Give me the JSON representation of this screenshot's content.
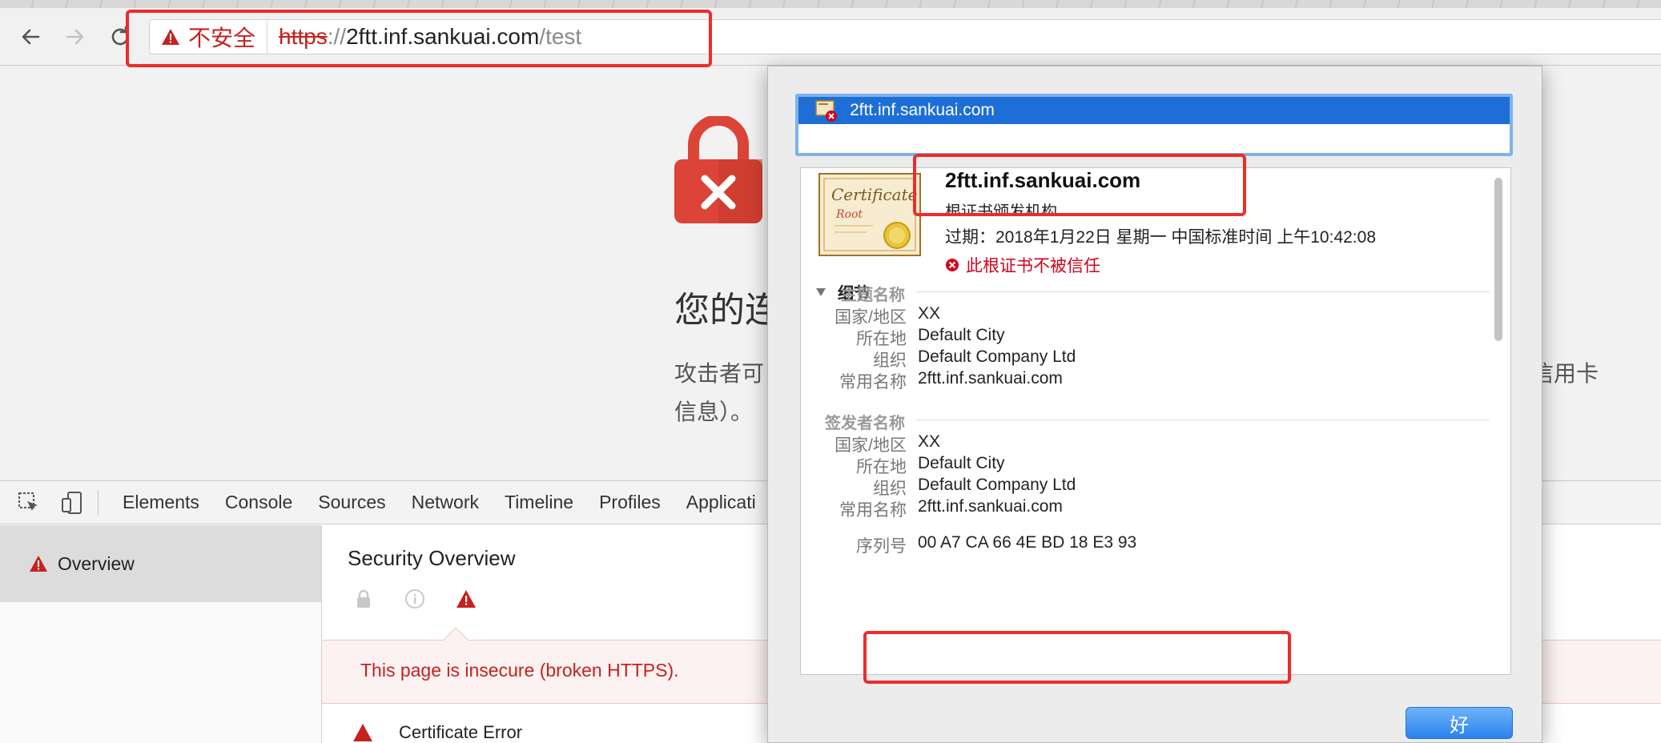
{
  "browser": {
    "security_chip": "不安全",
    "url_scheme": "https",
    "url_sep": "://",
    "url_host": "2ftt.inf.sankuai.com",
    "url_path": "/test"
  },
  "page": {
    "heading": "您的连",
    "text_line1": "攻击者可",
    "text_line2": "信息）。",
    "text_right": "信用卡"
  },
  "devtools": {
    "tabs": [
      "Elements",
      "Console",
      "Sources",
      "Network",
      "Timeline",
      "Profiles",
      "Applicati"
    ],
    "sidebar_item": "Overview",
    "security_title": "Security Overview",
    "insecure_message": "This page is insecure (broken HTTPS).",
    "cert_error": "Certificate Error"
  },
  "certificate": {
    "list_item": "2ftt.inf.sankuai.com",
    "name": "2ftt.inf.sankuai.com",
    "subtitle": "根证书颁发机构",
    "expires": "过期：2018年1月22日 星期一 中国标准时间 上午10:42:08",
    "warning": "此根证书不被信任",
    "details_label": "细节",
    "subject": {
      "heading": "主题名称",
      "rows": [
        {
          "key": "国家/地区",
          "value": "XX"
        },
        {
          "key": "所在地",
          "value": "Default City"
        },
        {
          "key": "组织",
          "value": "Default Company Ltd"
        },
        {
          "key": "常用名称",
          "value": "2ftt.inf.sankuai.com"
        }
      ]
    },
    "issuer": {
      "heading": "签发者名称",
      "rows": [
        {
          "key": "国家/地区",
          "value": "XX"
        },
        {
          "key": "所在地",
          "value": "Default City"
        },
        {
          "key": "组织",
          "value": "Default Company Ltd"
        },
        {
          "key": "常用名称",
          "value": "2ftt.inf.sankuai.com"
        }
      ]
    },
    "serial": {
      "key": "序列号",
      "value": "00 A7 CA 66 4E BD 18 E3 93"
    },
    "ok_button": "好"
  },
  "colors": {
    "insecure_red": "#c5221f",
    "highlight_red": "#ee2b2b",
    "selection_blue": "#1d6fd7"
  }
}
